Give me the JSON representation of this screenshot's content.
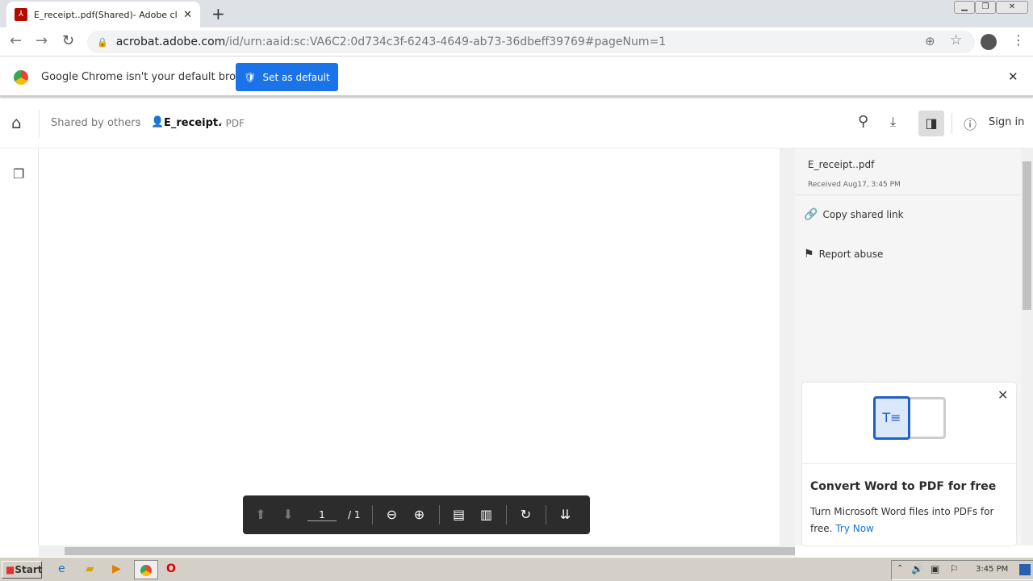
{
  "browser": {
    "tab_title": "E_receipt..pdf(Shared)- Adobe cloud",
    "url_host": "acrobat.adobe.com",
    "url_path": "/id/urn:aaid:sc:VA6C2:0d734c3f-6243-4649-ab73-36dbeff39769#pageNum=1"
  },
  "infobar": {
    "message": "Google Chrome isn't your default browser",
    "button": "Set as default"
  },
  "header": {
    "breadcrumb_parent": "Shared by others",
    "file_name": "E_receipt.",
    "file_type": "· PDF",
    "sign_in": "Sign in"
  },
  "panel": {
    "file_name": "E_receipt..pdf",
    "received": "Received Aug17, 3:45 PM",
    "copy_link": "Copy shared link",
    "report": "Report abuse"
  },
  "promo": {
    "title": "Convert Word to PDF for free",
    "body": "Turn Microsoft Word files into PDFs for free.",
    "link": "Try Now"
  },
  "toolbar": {
    "page_current": "1",
    "page_total": "/ 1"
  },
  "taskbar": {
    "start": "Start",
    "clock": "3:45 PM"
  }
}
